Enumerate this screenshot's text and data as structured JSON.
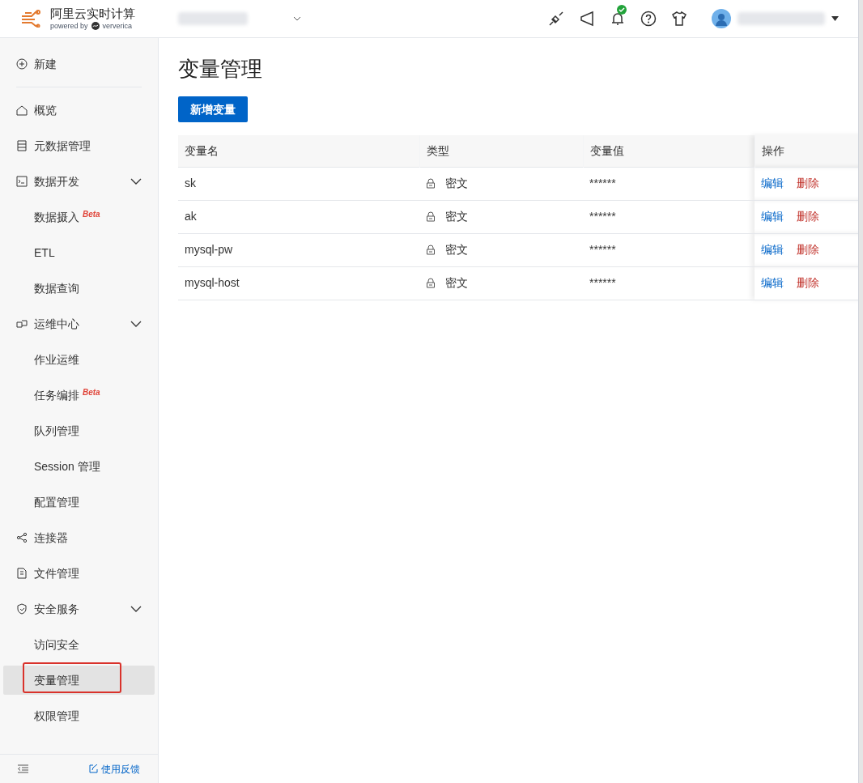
{
  "brand": {
    "title": "阿里云实时计算",
    "subtitle": "powered by",
    "partner": "ververica"
  },
  "header": {
    "notifications_ok": true
  },
  "sidebar": {
    "create": "新建",
    "items": [
      {
        "label": "概览",
        "kind": "home",
        "selected": false
      },
      {
        "label": "元数据管理",
        "kind": "db",
        "selected": false
      },
      {
        "label": "数据开发",
        "kind": "terminal",
        "expanded": true,
        "selected": false,
        "children": [
          {
            "label": "数据摄入",
            "badge": "Beta",
            "selected": false
          },
          {
            "label": "ETL",
            "selected": false
          },
          {
            "label": "数据查询",
            "selected": false
          }
        ]
      },
      {
        "label": "运维中心",
        "kind": "ops",
        "expanded": true,
        "selected": false,
        "children": [
          {
            "label": "作业运维",
            "selected": false
          },
          {
            "label": "任务编排",
            "badge": "Beta",
            "selected": false
          },
          {
            "label": "队列管理",
            "selected": false
          },
          {
            "label": "Session 管理",
            "selected": false
          },
          {
            "label": "配置管理",
            "selected": false
          }
        ]
      },
      {
        "label": "连接器",
        "kind": "share",
        "selected": false
      },
      {
        "label": "文件管理",
        "kind": "file",
        "selected": false
      },
      {
        "label": "安全服务",
        "kind": "shield",
        "expanded": true,
        "selected": false,
        "children": [
          {
            "label": "访问安全",
            "selected": false
          },
          {
            "label": "变量管理",
            "selected": true
          },
          {
            "label": "权限管理",
            "selected": false
          }
        ]
      }
    ],
    "feedback": "使用反馈"
  },
  "page": {
    "title": "变量管理",
    "add_button": "新增变量"
  },
  "table": {
    "columns": [
      "变量名",
      "类型",
      "变量值",
      "操作"
    ],
    "rows": [
      {
        "name": "sk",
        "type": "密文",
        "value": "******",
        "actions": [
          "编辑",
          "删除"
        ]
      },
      {
        "name": "ak",
        "type": "密文",
        "value": "******",
        "actions": [
          "编辑",
          "删除"
        ]
      },
      {
        "name": "mysql-pw",
        "type": "密文",
        "value": "******",
        "actions": [
          "编辑",
          "删除"
        ]
      },
      {
        "name": "mysql-host",
        "type": "密文",
        "value": "******",
        "actions": [
          "编辑",
          "删除"
        ]
      }
    ]
  }
}
